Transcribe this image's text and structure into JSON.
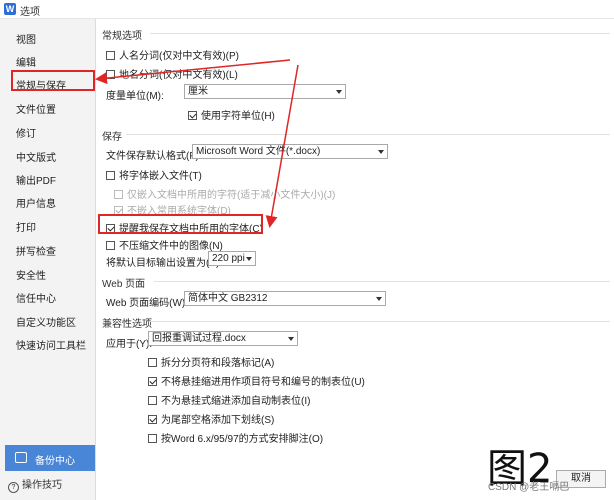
{
  "window": {
    "icon_text": "W",
    "title": "选项"
  },
  "sidebar": {
    "items": [
      {
        "label": "视图"
      },
      {
        "label": "编辑"
      },
      {
        "label": "常规与保存"
      },
      {
        "label": "文件位置"
      },
      {
        "label": "修订"
      },
      {
        "label": "中文版式"
      },
      {
        "label": "输出PDF"
      },
      {
        "label": "用户信息"
      },
      {
        "label": "打印"
      },
      {
        "label": "拼写检查"
      },
      {
        "label": "安全性"
      },
      {
        "label": "信任中心"
      },
      {
        "label": "自定义功能区"
      },
      {
        "label": "快速访问工具栏"
      }
    ],
    "active_index": 2,
    "backup_label": "备份中心",
    "tips_label": "操作技巧"
  },
  "general": {
    "title": "常规选项",
    "name_split": "人名分词(仅对中文有效)(P)",
    "place_split": "地名分词(仅对中文有效)(L)",
    "unit_label": "度量单位(M):",
    "unit_value": "厘米",
    "char_unit": "使用字符单位(H)"
  },
  "save": {
    "title": "保存",
    "format_label": "文件保存默认格式(F):",
    "format_value": "Microsoft Word 文件(*.docx)",
    "embed_fonts": "将字体嵌入文件(T)",
    "embed_used_only": "仅嵌入文档中所用的字符(适于减小文件大小)(J)",
    "no_common_fonts": "不嵌入常用系统字体(D)",
    "remind_fonts": "提醒我保存文档中所用的字体(C)",
    "no_compress": "不压缩文件中的图像(N)",
    "ppi_label": "将默认目标输出设置为(P):",
    "ppi_value": "220 ppi"
  },
  "web": {
    "title": "Web 页面",
    "encoding_label": "Web 页面编码(W):",
    "encoding_value": "简体中文 GB2312"
  },
  "compat": {
    "title": "兼容性选项",
    "apply_label": "应用于(Y):",
    "apply_value": "回报重调试过程.docx",
    "opt1": "拆分分页符和段落标记(A)",
    "opt2": "不将悬挂缩进用作项目符号和编号的制表位(U)",
    "opt3": "不为悬挂式缩进添加自动制表位(I)",
    "opt4": "为尾部空格添加下划线(S)",
    "opt5": "按Word 6.x/95/97的方式安排脚注(O)"
  },
  "overlay": {
    "figure_label": "图2",
    "csdn_text": "CSDN @老王嗝巴"
  },
  "buttons": {
    "cancel": "取消"
  },
  "accent": {
    "red": "#e02525",
    "blue": "#4a86d8"
  }
}
